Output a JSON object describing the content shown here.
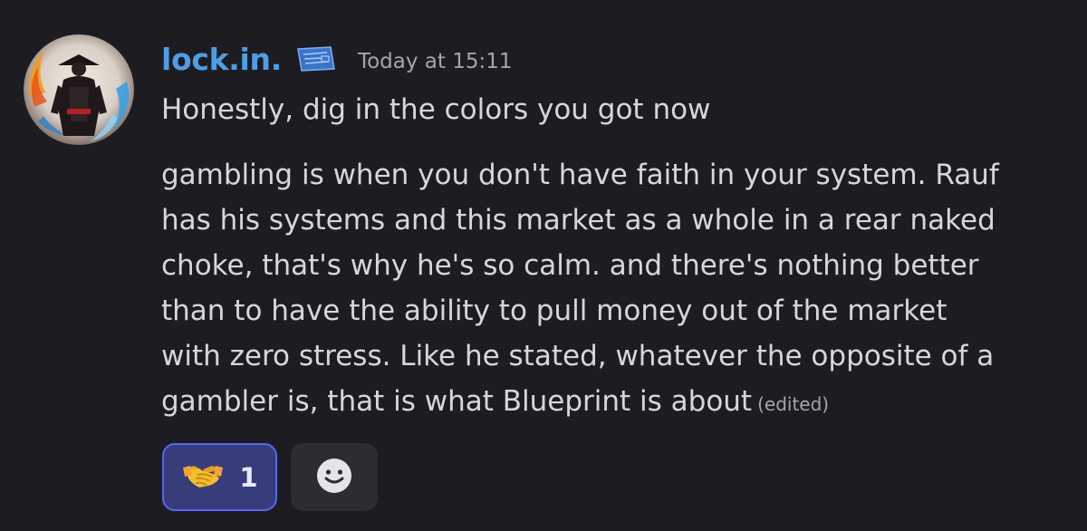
{
  "message": {
    "username": "lock.in.",
    "role_badge_icon": "blueprint-badge-icon",
    "timestamp": "Today at 15:11",
    "first_line": "Honestly, dig in the colors you got now",
    "body_lines": [
      "gambling is when you don't have faith in your system. Rauf",
      "has his systems and this market as a whole in a rear naked",
      "choke, that's why he's so calm. and there's nothing better",
      "than to have the ability to pull money out of the market",
      "with zero stress. Like he stated,  whatever the opposite of a",
      "gambler is, that is what Blueprint is about"
    ],
    "edited_label": "(edited)"
  },
  "reactions": [
    {
      "emoji": "🤝",
      "icon": "handshake-icon",
      "count": "1",
      "selected": true
    }
  ],
  "add_reaction_icon": "smiley-icon",
  "colors": {
    "background": "#1d1d21",
    "username": "#4f9de6",
    "text": "#d6d7da",
    "muted": "#a3a6ad",
    "reaction_bg": "#373c7b",
    "reaction_border": "#5865f2"
  }
}
